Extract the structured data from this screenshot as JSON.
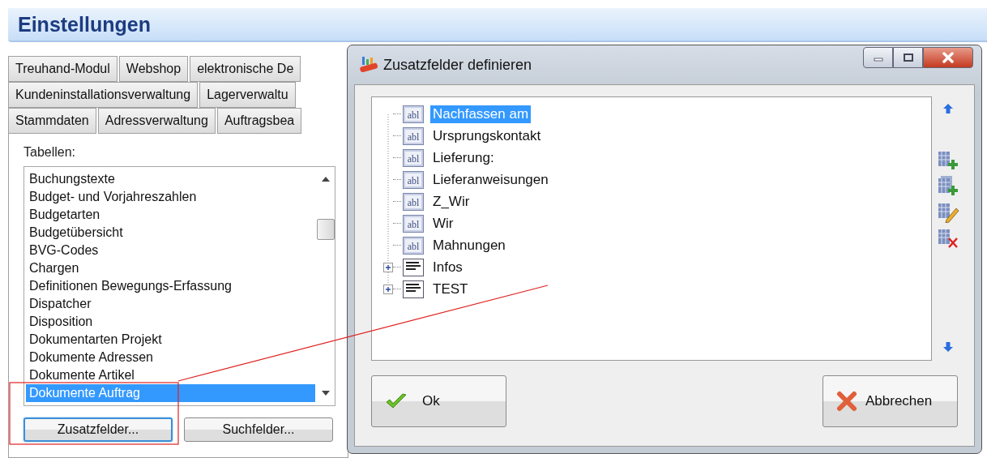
{
  "settings": {
    "title": "Einstellungen",
    "tab_rows": [
      [
        "Treuhand-Modul",
        "Webshop",
        "elektronische De"
      ],
      [
        "Kundeninstallationsverwaltung",
        "Lagerverwaltu"
      ],
      [
        "Stammdaten",
        "Adressverwaltung",
        "Auftragsbea"
      ]
    ],
    "tables_label": "Tabellen:",
    "tables": [
      {
        "label": "Buchungstexte",
        "selected": false
      },
      {
        "label": "Budget- und Vorjahreszahlen",
        "selected": false
      },
      {
        "label": "Budgetarten",
        "selected": false
      },
      {
        "label": "Budgetübersicht",
        "selected": false
      },
      {
        "label": "BVG-Codes",
        "selected": false
      },
      {
        "label": "Chargen",
        "selected": false
      },
      {
        "label": "Definitionen Bewegungs-Erfassung",
        "selected": false
      },
      {
        "label": "Dispatcher",
        "selected": false
      },
      {
        "label": "Disposition",
        "selected": false
      },
      {
        "label": "Dokumentarten Projekt",
        "selected": false
      },
      {
        "label": "Dokumente Adressen",
        "selected": false
      },
      {
        "label": "Dokumente Artikel",
        "selected": false
      },
      {
        "label": "Dokumente Auftrag",
        "selected": true
      }
    ],
    "buttons": [
      {
        "label": "Zusatzfelder...",
        "focused": true
      },
      {
        "label": "Suchfelder...",
        "focused": false
      }
    ]
  },
  "dialog": {
    "title": "Zusatzfelder definieren",
    "fields": [
      {
        "label": "Nachfassen am",
        "kind": "field",
        "icon_text": "abl",
        "selected": true
      },
      {
        "label": "Ursprungskontakt",
        "kind": "field",
        "icon_text": "abl",
        "selected": false
      },
      {
        "label": "Lieferung:",
        "kind": "field",
        "icon_text": "abl",
        "selected": false
      },
      {
        "label": "Lieferanweisungen",
        "kind": "field",
        "icon_text": "abl",
        "selected": false
      },
      {
        "label": "Z_Wir",
        "kind": "field",
        "icon_text": "abl",
        "selected": false
      },
      {
        "label": "Wir",
        "kind": "field",
        "icon_text": "abl",
        "selected": false
      },
      {
        "label": "Mahnungen",
        "kind": "field",
        "icon_text": "abl",
        "selected": false
      },
      {
        "label": "Infos",
        "kind": "group",
        "selected": false
      },
      {
        "label": "TEST",
        "kind": "group",
        "selected": false
      }
    ],
    "ok": "Ok",
    "cancel": "Abbrechen"
  }
}
